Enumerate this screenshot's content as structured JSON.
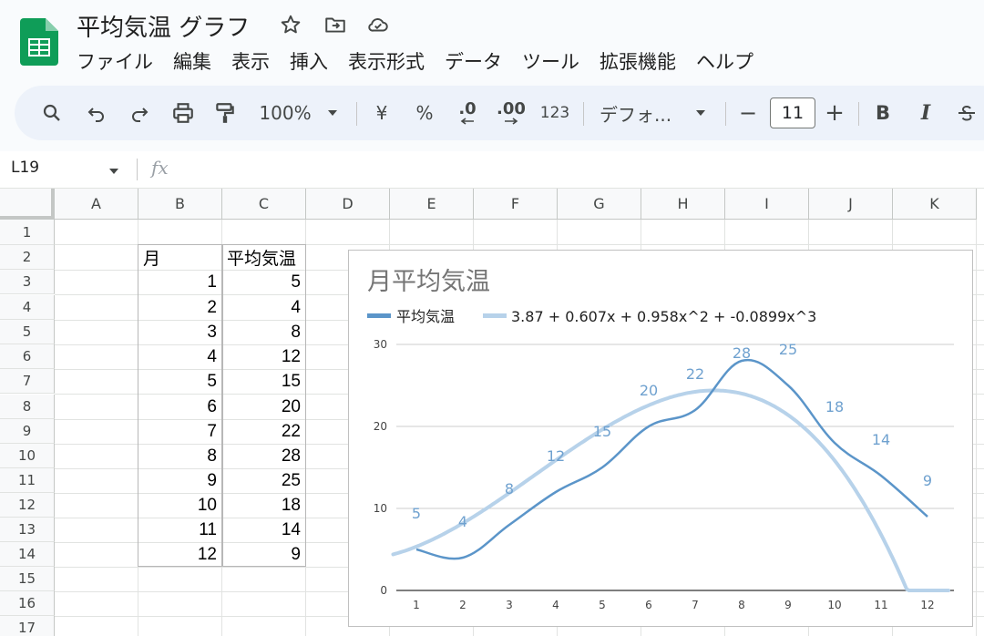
{
  "document": {
    "title": "平均気温 グラフ"
  },
  "menu": [
    "ファイル",
    "編集",
    "表示",
    "挿入",
    "表示形式",
    "データ",
    "ツール",
    "拡張機能",
    "ヘルプ"
  ],
  "toolbar": {
    "zoom": "100%",
    "currency": "¥",
    "percent": "%",
    "decrease_decimal": ".0",
    "increase_decimal": ".00",
    "more_formats": "123",
    "font": "デフォ...",
    "font_size": "11",
    "minus": "−",
    "plus": "+",
    "bold": "B",
    "italic": "I"
  },
  "formula_bar": {
    "cell_ref": "L19",
    "fx": "fx"
  },
  "columns": [
    "A",
    "B",
    "C",
    "D",
    "E",
    "F",
    "G",
    "H",
    "I",
    "J",
    "K"
  ],
  "rows": [
    "1",
    "2",
    "3",
    "4",
    "5",
    "6",
    "7",
    "8",
    "9",
    "10",
    "11",
    "12",
    "13",
    "14",
    "15",
    "16",
    "17"
  ],
  "table": {
    "header": [
      "月",
      "平均気温"
    ],
    "months": [
      "1",
      "2",
      "3",
      "4",
      "5",
      "6",
      "7",
      "8",
      "9",
      "10",
      "11",
      "12"
    ],
    "temps": [
      "5",
      "4",
      "8",
      "12",
      "15",
      "20",
      "22",
      "28",
      "25",
      "18",
      "14",
      "9"
    ]
  },
  "chart_data": {
    "type": "line",
    "title": "月平均気温",
    "categories": [
      "1",
      "2",
      "3",
      "4",
      "5",
      "6",
      "7",
      "8",
      "9",
      "10",
      "11",
      "12"
    ],
    "x": [
      1,
      2,
      3,
      4,
      5,
      6,
      7,
      8,
      9,
      10,
      11,
      12
    ],
    "series": [
      {
        "name": "平均気温",
        "values": [
          5,
          4,
          8,
          12,
          15,
          20,
          22,
          28,
          25,
          18,
          14,
          9
        ],
        "color": "#5b95c9"
      },
      {
        "name": "3.87 + 0.607x + 0.958x^2 + -0.0899x^3",
        "type": "trendline",
        "coefficients": [
          3.87,
          0.607,
          0.958,
          -0.0899
        ],
        "color": "#b7d2ea"
      }
    ],
    "data_labels": [
      "5",
      "4",
      "8",
      "12",
      "15",
      "20",
      "22",
      "28",
      "25",
      "18",
      "14",
      "9"
    ],
    "y_ticks": [
      "0",
      "10",
      "20",
      "30"
    ],
    "x_ticks": [
      "1",
      "2",
      "3",
      "4",
      "5",
      "6",
      "7",
      "8",
      "9",
      "10",
      "11",
      "12"
    ],
    "ylim": [
      0,
      30
    ],
    "xlabel": "",
    "ylabel": "",
    "grid": true,
    "legend": "top"
  }
}
